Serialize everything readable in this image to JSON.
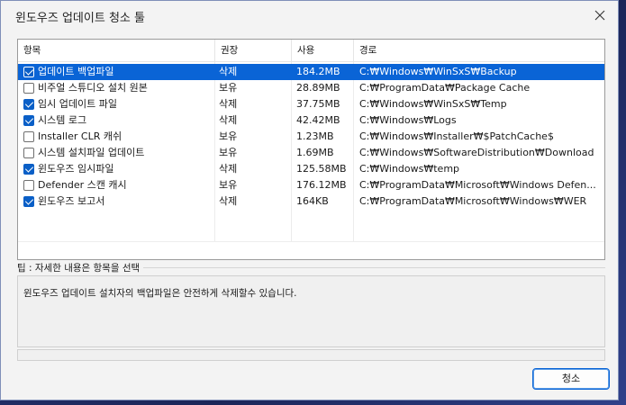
{
  "window": {
    "title": "윈도우즈 업데이트 청소 툴"
  },
  "columns": [
    "항목",
    "권장",
    "사용",
    "경로"
  ],
  "rows": [
    {
      "checked": true,
      "selected": true,
      "name": "업데이트 백업파일",
      "recommend": "삭제",
      "size": "184.2MB",
      "path": "C:₩Windows₩WinSxS₩Backup"
    },
    {
      "checked": false,
      "selected": false,
      "name": "비주얼 스튜디오 설치 원본",
      "recommend": "보유",
      "size": "28.89MB",
      "path": "C:₩ProgramData₩Package Cache"
    },
    {
      "checked": true,
      "selected": false,
      "name": "임시 업데이트 파일",
      "recommend": "삭제",
      "size": "37.75MB",
      "path": "C:₩Windows₩WinSxS₩Temp"
    },
    {
      "checked": true,
      "selected": false,
      "name": "시스템 로그",
      "recommend": "삭제",
      "size": "42.42MB",
      "path": "C:₩Windows₩Logs"
    },
    {
      "checked": false,
      "selected": false,
      "name": "Installer CLR 캐쉬",
      "recommend": "보유",
      "size": "1.23MB",
      "path": "C:₩Windows₩Installer₩$PatchCache$"
    },
    {
      "checked": false,
      "selected": false,
      "name": "시스템 설치파일 업데이트",
      "recommend": "보유",
      "size": "1.69MB",
      "path": "C:₩Windows₩SoftwareDistribution₩Download"
    },
    {
      "checked": true,
      "selected": false,
      "name": "윈도우즈 임시파일",
      "recommend": "삭제",
      "size": "125.58MB",
      "path": "C:₩Windows₩temp"
    },
    {
      "checked": false,
      "selected": false,
      "name": "Defender 스캔 캐시",
      "recommend": "보유",
      "size": "176.12MB",
      "path": "C:₩ProgramData₩Microsoft₩Windows Defen..."
    },
    {
      "checked": true,
      "selected": false,
      "name": "윈도우즈 보고서",
      "recommend": "삭제",
      "size": "164KB",
      "path": "C:₩ProgramData₩Microsoft₩Windows₩WER"
    }
  ],
  "tip": {
    "label": "팁 : 자세한 내용은 항목을 선택",
    "text": "윈도우즈 업데이트 설치자의 백업파일은 안전하게 삭제할수 있습니다."
  },
  "buttons": {
    "clean": "청소"
  },
  "colors": {
    "selection": "#0a64d6",
    "checkbox": "#0a5fc7",
    "background": "#f3f3f3"
  },
  "icons": {
    "close": "close-icon",
    "checkbox": "checkbox-icon"
  }
}
